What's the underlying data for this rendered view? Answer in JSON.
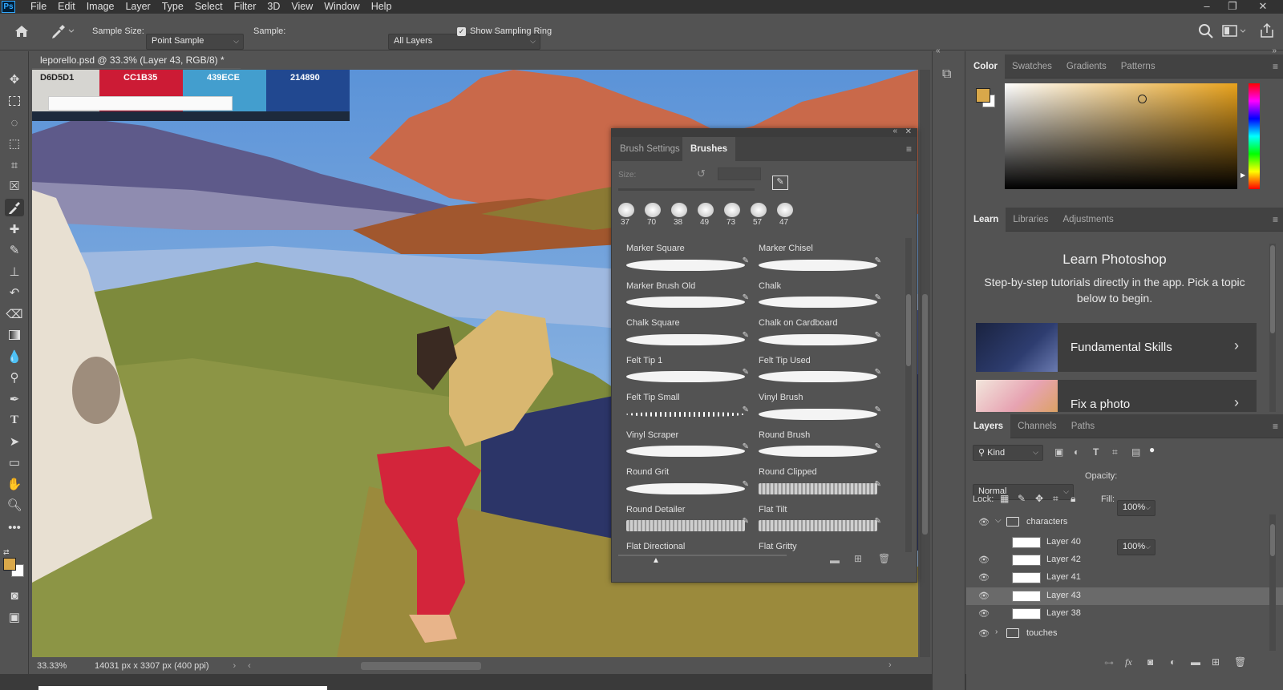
{
  "app": {
    "logo": "Ps"
  },
  "menu": [
    "File",
    "Edit",
    "Image",
    "Layer",
    "Type",
    "Select",
    "Filter",
    "3D",
    "View",
    "Window",
    "Help"
  ],
  "options": {
    "sample_size_label": "Sample Size:",
    "sample_size_value": "Point Sample",
    "sample_label": "Sample:",
    "sample_value": "All Layers",
    "sampling_ring_label": "Show Sampling Ring"
  },
  "document": {
    "tab_title": "leporello.psd @ 33.3% (Layer 43, RGB/8) *",
    "zoom": "33.33%",
    "doc_info": "14031 px x 3307 px (400 ppi)"
  },
  "swatches_overlay": [
    {
      "hex": "D6D5D1",
      "color": "#d6d5d1",
      "text_color": "#222"
    },
    {
      "hex": "CC1B35",
      "color": "#cc1b35",
      "text_color": "#fff"
    },
    {
      "hex": "439ECE",
      "color": "#439ece",
      "text_color": "#fff"
    },
    {
      "hex": "214890",
      "color": "#214890",
      "text_color": "#fff"
    }
  ],
  "brushes_panel": {
    "tabs": [
      "Brush Settings",
      "Brushes"
    ],
    "active_tab": "Brushes",
    "size_label": "Size:",
    "recent_sizes": [
      "37",
      "70",
      "38",
      "49",
      "73",
      "57",
      "47"
    ],
    "items": [
      "Marker Square",
      "Marker Chisel",
      "Marker Brush Old",
      "Chalk",
      "Chalk Square",
      "Chalk on Cardboard",
      "Felt Tip 1",
      "Felt Tip Used",
      "Felt Tip Small",
      "Vinyl Brush",
      "Vinyl Scraper",
      "Round Brush",
      "Round Grit",
      "Round Clipped",
      "Round Detailer",
      "Flat Tilt",
      "Flat Directional",
      "Flat Gritty"
    ]
  },
  "color_panel": {
    "tabs": [
      "Color",
      "Swatches",
      "Gradients",
      "Patterns"
    ],
    "foreground": "#d9a84a",
    "background": "#ffffff"
  },
  "learn_panel": {
    "tabs": [
      "Learn",
      "Libraries",
      "Adjustments"
    ],
    "title": "Learn Photoshop",
    "description": "Step-by-step tutorials directly in the app. Pick a topic below to begin.",
    "cards": [
      "Fundamental Skills",
      "Fix a photo"
    ]
  },
  "layers_panel": {
    "tabs": [
      "Layers",
      "Channels",
      "Paths"
    ],
    "filter_label": "Kind",
    "blend_mode": "Normal",
    "opacity_label": "Opacity:",
    "opacity": "100%",
    "lock_label": "Lock:",
    "fill_label": "Fill:",
    "fill": "100%",
    "layers": [
      {
        "name": "characters",
        "type": "group",
        "visible": true,
        "expanded": true
      },
      {
        "name": "Layer 40",
        "type": "layer",
        "visible": false
      },
      {
        "name": "Layer 42",
        "type": "layer",
        "visible": true
      },
      {
        "name": "Layer 41",
        "type": "layer",
        "visible": true
      },
      {
        "name": "Layer 43",
        "type": "layer",
        "visible": true,
        "selected": true
      },
      {
        "name": "Layer 38",
        "type": "layer",
        "visible": true
      },
      {
        "name": "touches",
        "type": "group",
        "visible": true,
        "expanded": false
      }
    ]
  }
}
